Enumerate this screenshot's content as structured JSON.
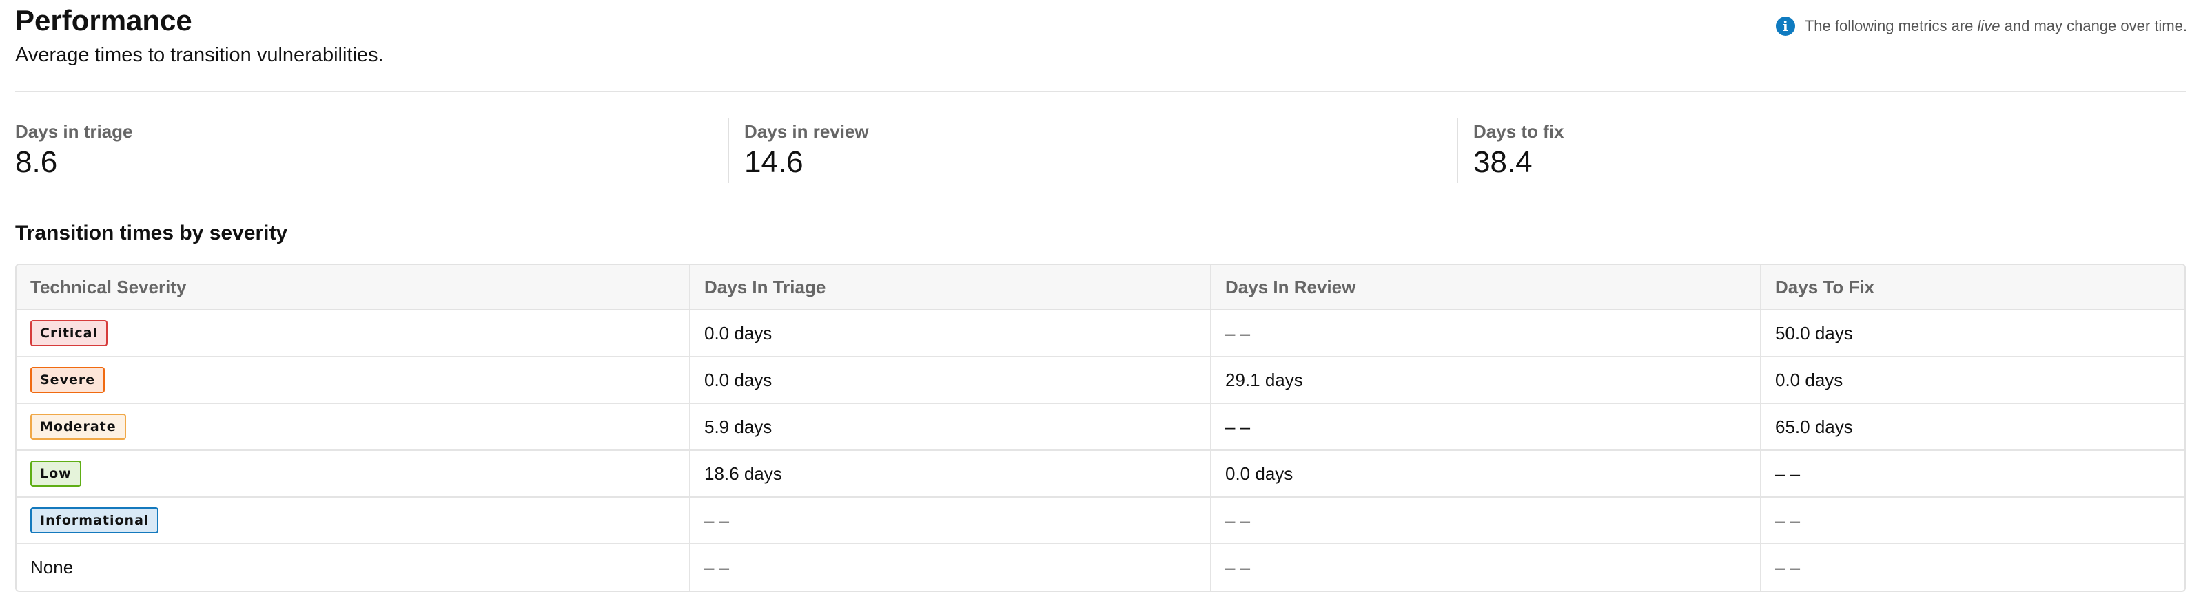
{
  "header": {
    "title": "Performance",
    "subtitle": "Average times to transition vulnerabilities.",
    "notice": {
      "icon": "info-icon",
      "prefix": "The following metrics are ",
      "emphasis": "live",
      "suffix": " and may change over time."
    }
  },
  "metrics": [
    {
      "label": "Days in triage",
      "value": "8.6"
    },
    {
      "label": "Days in review",
      "value": "14.6"
    },
    {
      "label": "Days to fix",
      "value": "38.4"
    }
  ],
  "section_title": "Transition times by severity",
  "table": {
    "columns": [
      "Technical Severity",
      "Days In Triage",
      "Days In Review",
      "Days To Fix"
    ],
    "rows": [
      {
        "severity": "Critical",
        "badge": true,
        "bg": "#fbe0e0",
        "border": "#d63b3b",
        "triage": "0.0 days",
        "review": "– –",
        "fix": "50.0 days"
      },
      {
        "severity": "Severe",
        "badge": true,
        "bg": "#fde5d8",
        "border": "#f06a10",
        "triage": "0.0 days",
        "review": "29.1 days",
        "fix": "0.0 days"
      },
      {
        "severity": "Moderate",
        "badge": true,
        "bg": "#fdf1e3",
        "border": "#f0a848",
        "triage": "5.9 days",
        "review": "– –",
        "fix": "65.0 days"
      },
      {
        "severity": "Low",
        "badge": true,
        "bg": "#e5f3da",
        "border": "#5fae15",
        "triage": "18.6 days",
        "review": "0.0 days",
        "fix": "– –"
      },
      {
        "severity": "Informational",
        "badge": true,
        "bg": "#d9e9f6",
        "border": "#1479bd",
        "triage": "– –",
        "review": "– –",
        "fix": "– –"
      },
      {
        "severity": "None",
        "badge": false,
        "triage": "– –",
        "review": "– –",
        "fix": "– –"
      }
    ]
  }
}
